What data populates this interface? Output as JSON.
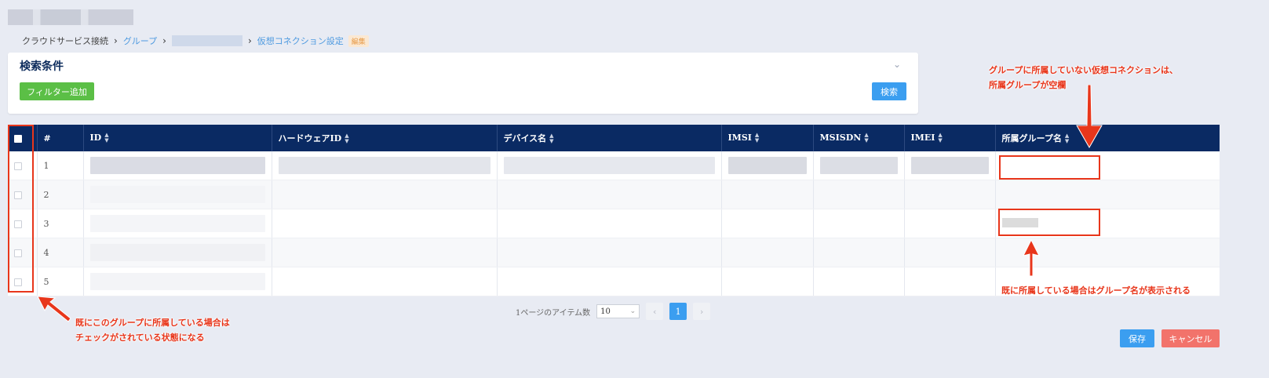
{
  "breadcrumb": {
    "item1": "クラウドサービス接続",
    "item2": "グループ",
    "item4": "仮想コネクション設定",
    "badge": "編集"
  },
  "search_panel": {
    "title": "検索条件",
    "filter_button": "フィルター追加",
    "search_button": "検索",
    "collapse_icon": "chevron-down-icon"
  },
  "table": {
    "columns": [
      "#",
      "ID",
      "ハードウェアID",
      "デバイス名",
      "IMSI",
      "MSISDN",
      "IMEI",
      "所属グループ名"
    ],
    "rows": [
      {
        "num": "1",
        "checked": false
      },
      {
        "num": "2",
        "checked": false
      },
      {
        "num": "3",
        "checked": false
      },
      {
        "num": "4",
        "checked": false
      },
      {
        "num": "5",
        "checked": false
      }
    ],
    "sort_icon": "sort-icon"
  },
  "annotations": {
    "right_top_line1": "グループに所属していない仮想コネクションは、",
    "right_top_line2": "所属グループが空欄",
    "right_bottom": "既に所属している場合はグループ名が表示される",
    "left_line1": "既にこのグループに所属している場合は",
    "left_line2": "チェックがされている状態になる",
    "color": "#e8361b"
  },
  "pagination": {
    "items_per_page_label": "1ページのアイテム数",
    "page_size": "10",
    "current_page": "1"
  },
  "actions": {
    "save": "保存",
    "cancel": "キャンセル"
  },
  "colors": {
    "header_bg": "#0a2a63",
    "primary": "#3b9ef0",
    "success": "#5bbf46",
    "danger": "#f2736b"
  }
}
